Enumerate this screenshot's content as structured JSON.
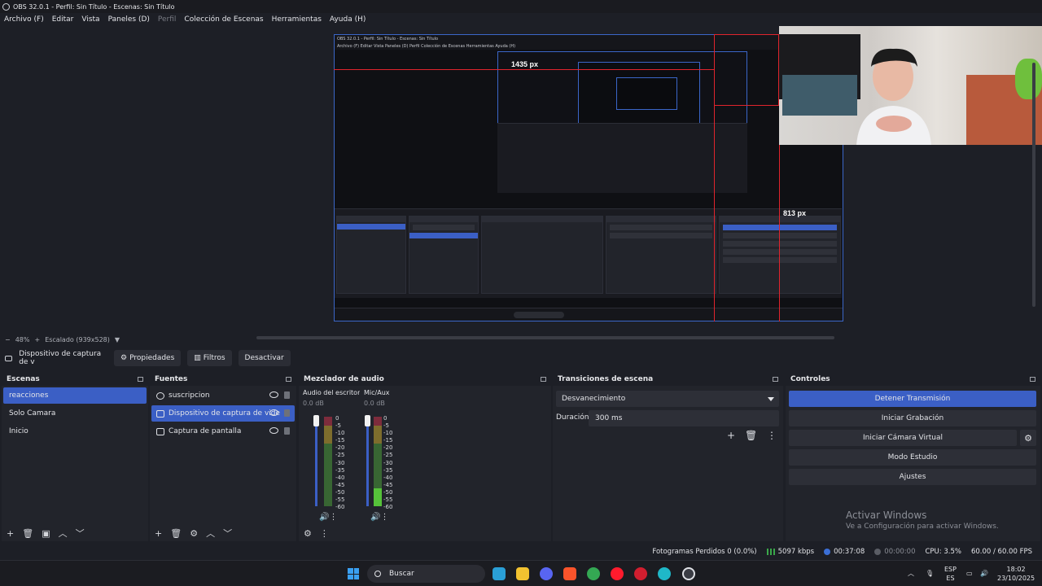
{
  "window": {
    "title": "OBS 32.0.1 - Perfil: Sin Título - Escenas: Sin Título"
  },
  "menu": [
    {
      "label": "Archivo (F)",
      "disabled": false
    },
    {
      "label": "Editar",
      "disabled": false
    },
    {
      "label": "Vista",
      "disabled": false
    },
    {
      "label": "Paneles (D)",
      "disabled": false
    },
    {
      "label": "Perfil",
      "disabled": true
    },
    {
      "label": "Colección de Escenas",
      "disabled": false
    },
    {
      "label": "Herramientas",
      "disabled": false
    },
    {
      "label": "Ayuda (H)",
      "disabled": false
    }
  ],
  "preview": {
    "measure_width": "1435 px",
    "measure_height": "813 px",
    "inner_title": "OBS 32.0.1 - Perfil: Sin Título - Escenas: Sin Título",
    "inner_menu": "Archivo (F)   Editar   Vista   Paneles (D)   Perfil   Colección de Escenas   Herramientas   Ayuda (H)"
  },
  "zoom": {
    "minus": "−",
    "percent": "48%",
    "plus": "+",
    "scale": "Escalado (939x528)"
  },
  "source_toolbar": {
    "source_name": "Dispositivo de captura de v",
    "properties": "Propiedades",
    "filters": "Filtros",
    "deactivate": "Desactivar"
  },
  "scenes": {
    "title": "Escenas",
    "items": [
      {
        "label": "reacciones",
        "selected": true
      },
      {
        "label": "Solo Camara",
        "selected": false
      },
      {
        "label": "Inicio",
        "selected": false
      }
    ]
  },
  "sources": {
    "title": "Fuentes",
    "items": [
      {
        "label": "suscripcion",
        "icon": "globe-icon",
        "selected": false
      },
      {
        "label": "Dispositivo de captura de vide",
        "icon": "camera-icon",
        "selected": true
      },
      {
        "label": "Captura de pantalla",
        "icon": "monitor-icon",
        "selected": false
      }
    ]
  },
  "mixer": {
    "title": "Mezclador de audio",
    "channels": [
      {
        "name": "Audio del escritoric",
        "db": "0.0 dB"
      },
      {
        "name": "Mic/Aux",
        "db": "0.0 dB"
      }
    ],
    "scale": [
      "0",
      "-5",
      "-10",
      "-15",
      "-20",
      "-25",
      "-30",
      "-35",
      "-40",
      "-45",
      "-50",
      "-55",
      "-60"
    ]
  },
  "transitions": {
    "title": "Transiciones de escena",
    "selected": "Desvanecimiento",
    "duration_label": "Duración",
    "duration_value": "300 ms"
  },
  "controls": {
    "title": "Controles",
    "stop_stream": "Detener Transmisión",
    "start_recording": "Iniciar Grabación",
    "start_virtual_cam": "Iniciar Cámara Virtual",
    "studio_mode": "Modo Estudio",
    "settings": "Ajustes",
    "activate_title": "Activar Windows",
    "activate_sub": "Ve a Configuración para activar Windows."
  },
  "status": {
    "dropped_frames": "Fotogramas Perdidos 0 (0.0%)",
    "bitrate": "5097 kbps",
    "stream_time": "00:37:08",
    "record_time": "00:00:00",
    "cpu": "CPU: 3.5%",
    "fps": "60.00 / 60.00 FPS"
  },
  "taskbar": {
    "search": "Buscar",
    "lang_top": "ESP",
    "lang_bottom": "ES",
    "time": "18:02",
    "date": "23/10/2025"
  },
  "colors": {
    "accent": "#3b5fc5",
    "background": "#1d1f26",
    "panel": "#22242b",
    "measure_red": "#e0242d"
  }
}
